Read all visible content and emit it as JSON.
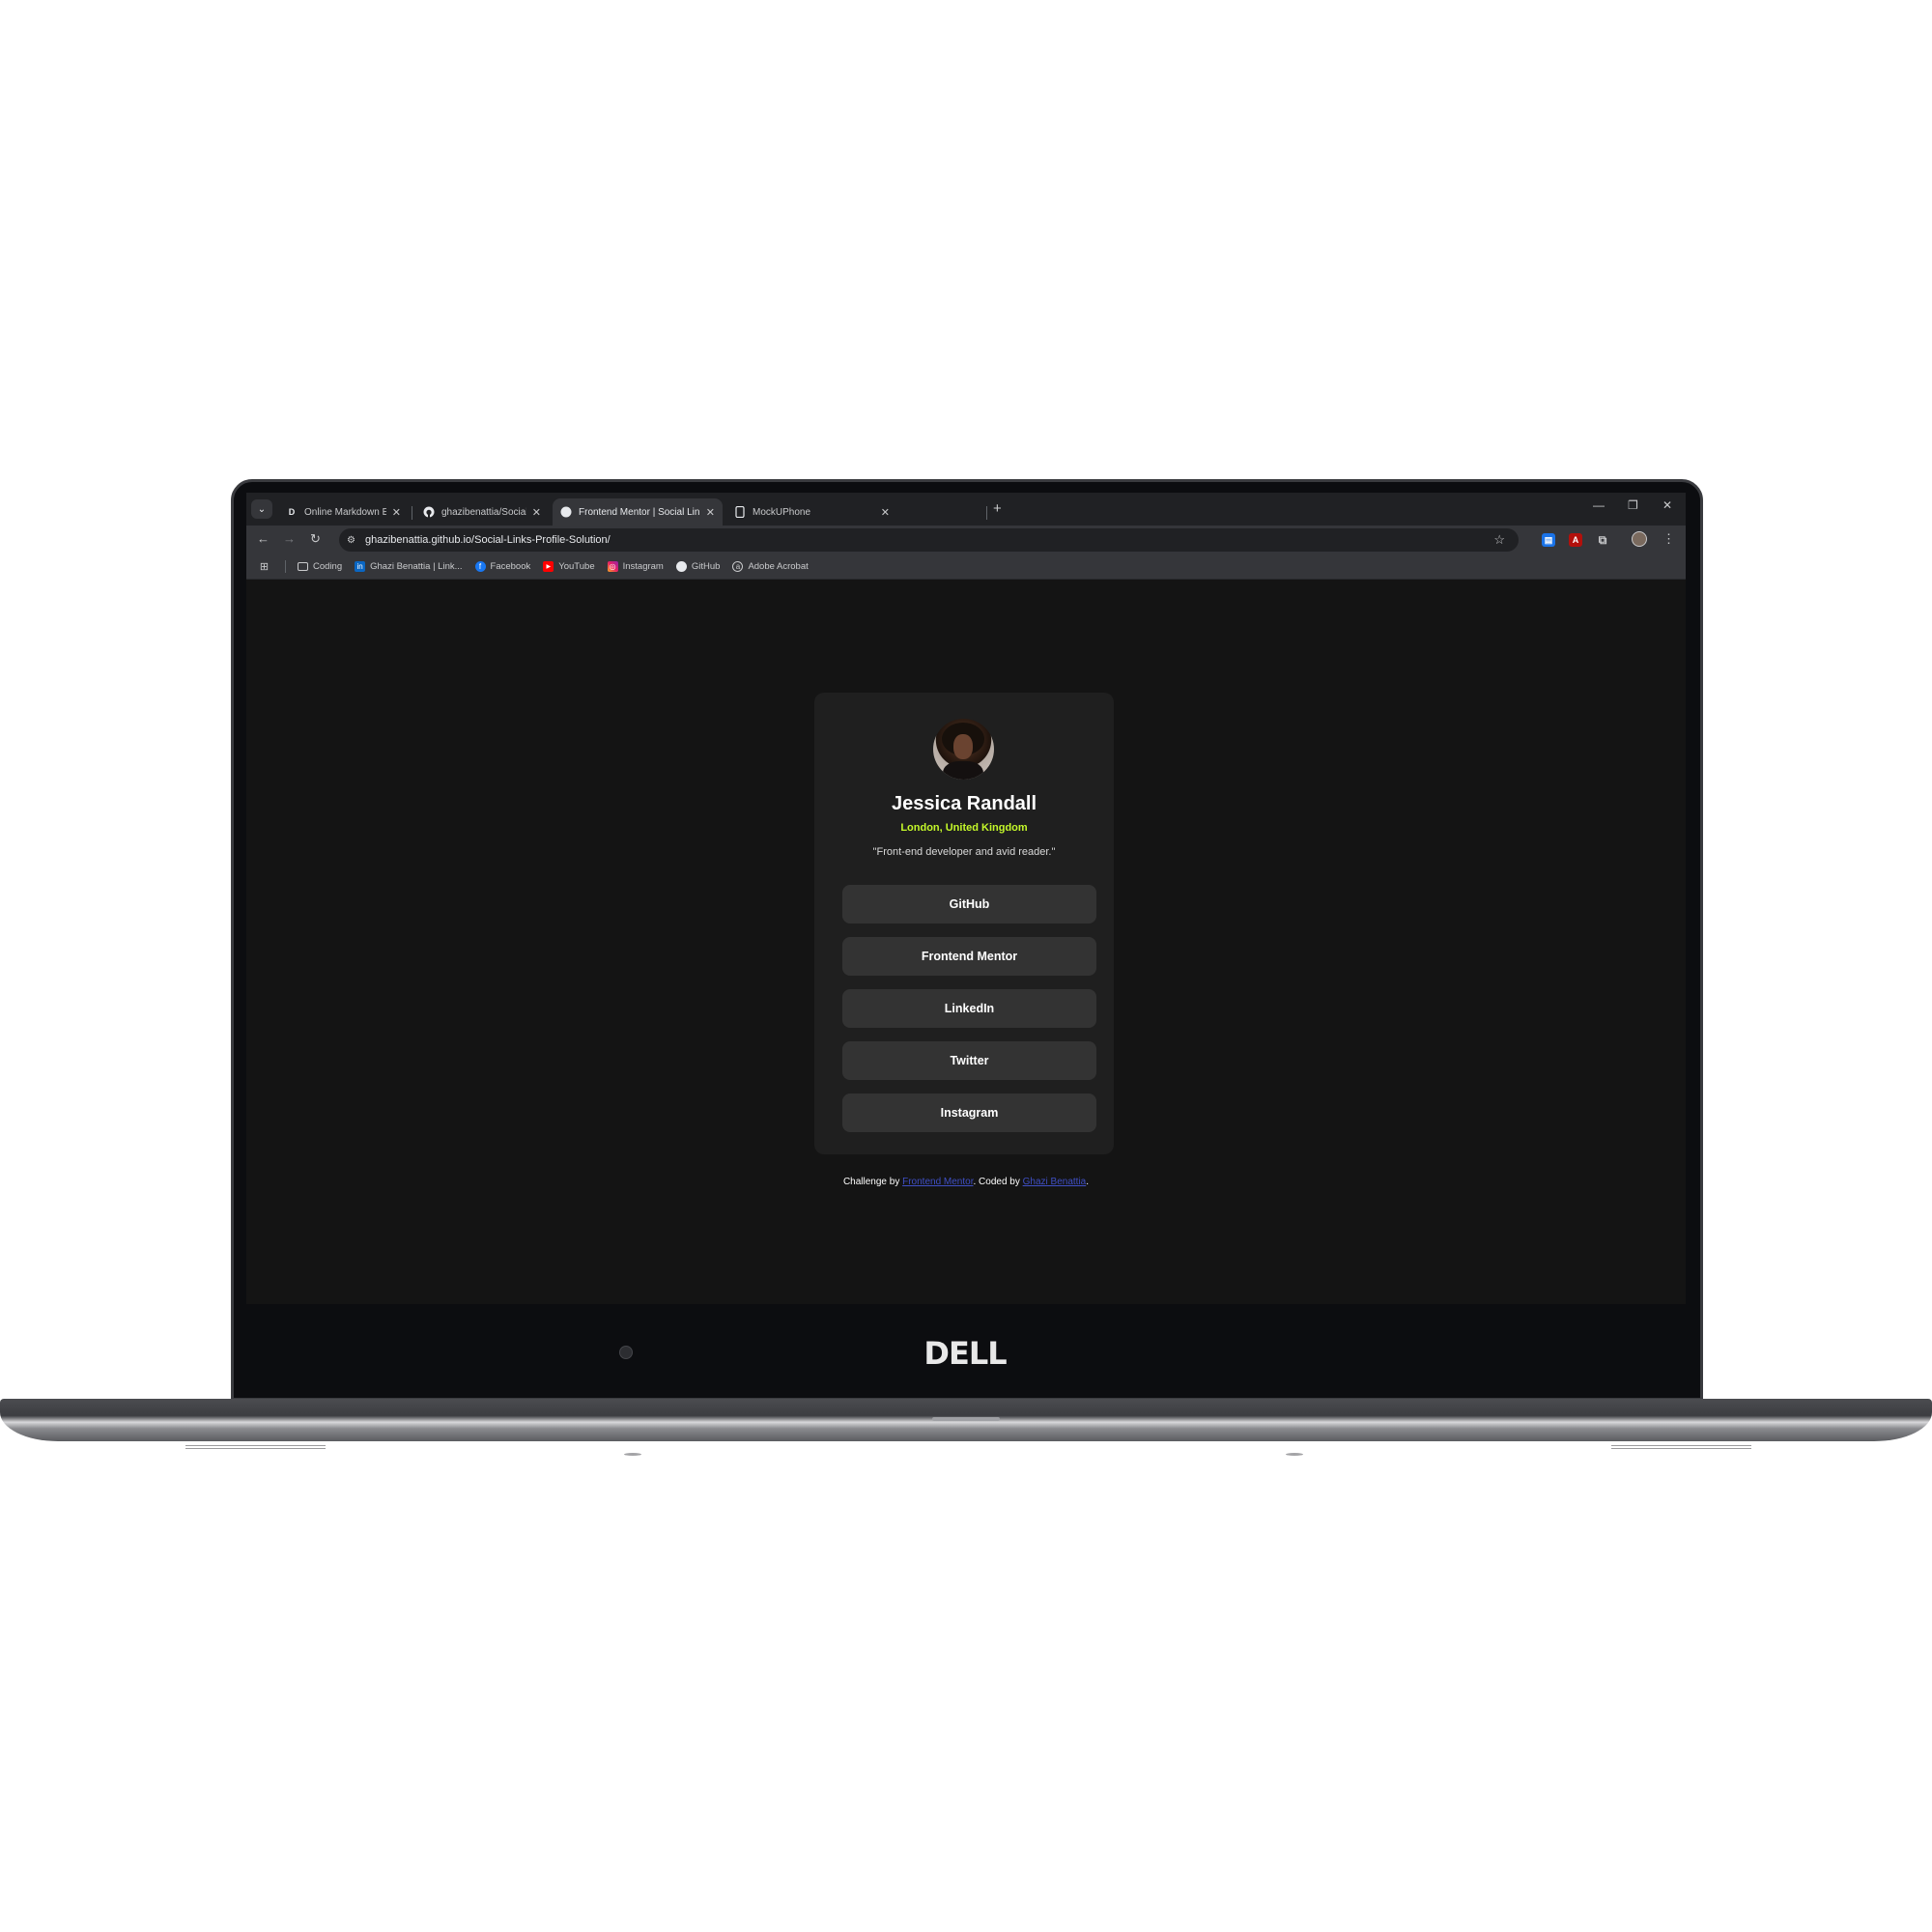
{
  "browser": {
    "tabs": [
      {
        "favicon": "D",
        "title": "Online Markdown Editor - Dillinger",
        "active": false
      },
      {
        "favicon": "github-icon",
        "title": "ghazibenattia/Social-Links-Profile",
        "active": false
      },
      {
        "favicon": "frontend-mentor-icon",
        "title": "Frontend Mentor | Social Links Profile",
        "active": true
      },
      {
        "favicon": "mockuphone-icon",
        "title": "MockUPhone",
        "active": false
      }
    ],
    "url": "ghazibenattia.github.io/Social-Links-Profile-Solution/",
    "bookmarks": [
      {
        "icon": "folder-icon",
        "label": "Coding"
      },
      {
        "icon": "linkedin-icon",
        "label": "Ghazi Benattia | Link..."
      },
      {
        "icon": "facebook-icon",
        "label": "Facebook"
      },
      {
        "icon": "youtube-icon",
        "label": "YouTube"
      },
      {
        "icon": "instagram-icon",
        "label": "Instagram"
      },
      {
        "icon": "github-icon",
        "label": "GitHub"
      },
      {
        "icon": "adobe-acrobat-icon",
        "label": "Adobe Acrobat"
      }
    ]
  },
  "profile": {
    "name": "Jessica Randall",
    "location": "London, United Kingdom",
    "bio": "\"Front-end developer and avid reader.\"",
    "links": [
      "GitHub",
      "Frontend Mentor",
      "LinkedIn",
      "Twitter",
      "Instagram"
    ]
  },
  "footer": {
    "prefix": "Challenge by ",
    "link1": "Frontend Mentor",
    "middle": ". Coded by ",
    "link2": "Ghazi Benattia",
    "suffix": "."
  },
  "device": {
    "brand": "DELL"
  },
  "colors": {
    "accent": "#c4f82a",
    "card": "#1f1f1f",
    "button": "#333333",
    "page_bg": "#141414"
  }
}
